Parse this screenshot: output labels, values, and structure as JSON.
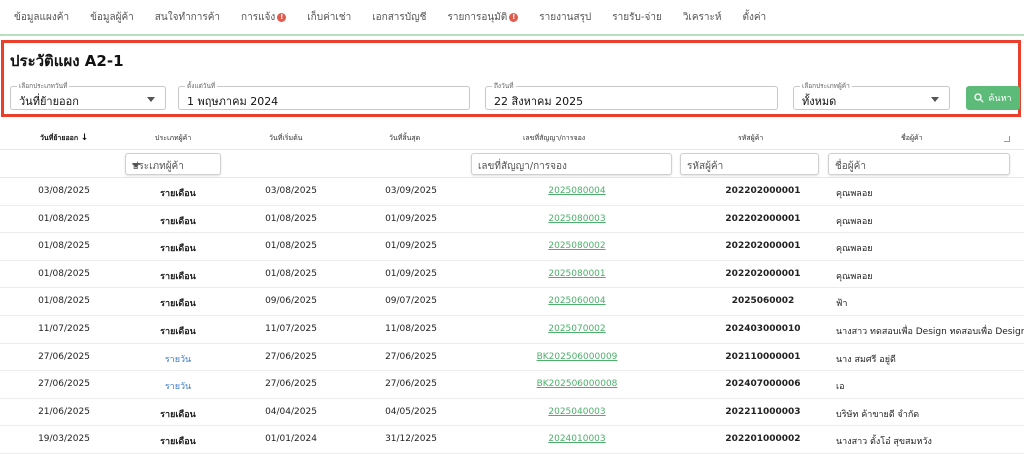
{
  "nav": [
    {
      "label": "ข้อมูลแผงค้า",
      "badge": ""
    },
    {
      "label": "ข้อมูลผู้ค้า",
      "badge": ""
    },
    {
      "label": "สนใจทำการค้า",
      "badge": ""
    },
    {
      "label": "การแจ้ง",
      "badge": "!"
    },
    {
      "label": "เก็บค่าเช่า",
      "badge": ""
    },
    {
      "label": "เอกสารบัญชี",
      "badge": ""
    },
    {
      "label": "รายการอนุมัติ",
      "badge": "!"
    },
    {
      "label": "รายงานสรุป",
      "badge": ""
    },
    {
      "label": "รายรับ-จ่าย",
      "badge": ""
    },
    {
      "label": "วิเคราะห์",
      "badge": ""
    },
    {
      "label": "ตั้งค่า",
      "badge": ""
    }
  ],
  "page_title": "ประวัติแผง A2-1",
  "filters": {
    "date_type": {
      "label": "เลือกประเภทวันที่",
      "value": "วันที่ย้ายออก"
    },
    "from_date": {
      "label": "ตั้งแต่วันที่",
      "value": "1 พฤษภาคม 2024"
    },
    "to_date": {
      "label": "ถึงวันที่",
      "value": "22 สิงหาคม 2025"
    },
    "customer_type": {
      "label": "เลือกประเภทผู้ค้า",
      "value": "ทั้งหมด"
    },
    "search_label": "ค้นหา"
  },
  "columns": {
    "move_out": "วันที่ย้ายออก",
    "customer_type": "ประเภทผู้ค้า",
    "start": "วันที่เริ่มต้น",
    "end": "วันที่สิ้นสุด",
    "contract": "เลขที่สัญญา/การจอง",
    "customer_code": "รหัสผู้ค้า",
    "customer_name": "ชื่อผู้ค้า"
  },
  "column_filters": {
    "customer_type": "ประเภทผู้ค้า",
    "contract": "เลขที่สัญญา/การจอง",
    "customer_code": "รหัสผู้ค้า",
    "customer_name": "ชื่อผู้ค้า"
  },
  "rows": [
    {
      "move_out": "03/08/2025",
      "type": "รายเดือน",
      "daily": false,
      "start": "03/08/2025",
      "end": "03/09/2025",
      "contract": "2025080004",
      "code": "202202000001",
      "name": "คุณพลอย"
    },
    {
      "move_out": "01/08/2025",
      "type": "รายเดือน",
      "daily": false,
      "start": "01/08/2025",
      "end": "01/09/2025",
      "contract": "2025080003",
      "code": "202202000001",
      "name": "คุณพลอย"
    },
    {
      "move_out": "01/08/2025",
      "type": "รายเดือน",
      "daily": false,
      "start": "01/08/2025",
      "end": "01/09/2025",
      "contract": "2025080002",
      "code": "202202000001",
      "name": "คุณพลอย"
    },
    {
      "move_out": "01/08/2025",
      "type": "รายเดือน",
      "daily": false,
      "start": "01/08/2025",
      "end": "01/09/2025",
      "contract": "2025080001",
      "code": "202202000001",
      "name": "คุณพลอย"
    },
    {
      "move_out": "01/08/2025",
      "type": "รายเดือน",
      "daily": false,
      "start": "09/06/2025",
      "end": "09/07/2025",
      "contract": "2025060004",
      "code": "2025060002",
      "name": "ฟ้า"
    },
    {
      "move_out": "11/07/2025",
      "type": "รายเดือน",
      "daily": false,
      "start": "11/07/2025",
      "end": "11/08/2025",
      "contract": "2025070002",
      "code": "202403000010",
      "name": "นางสาว ทดสอบเพื่อ Design ทดสอบเพื่อ Design"
    },
    {
      "move_out": "27/06/2025",
      "type": "รายวัน",
      "daily": true,
      "start": "27/06/2025",
      "end": "27/06/2025",
      "contract": "BK202506000009",
      "code": "202110000001",
      "name": "นาง สมศรี อยู่ดี"
    },
    {
      "move_out": "27/06/2025",
      "type": "รายวัน",
      "daily": true,
      "start": "27/06/2025",
      "end": "27/06/2025",
      "contract": "BK202506000008",
      "code": "202407000006",
      "name": "เอ"
    },
    {
      "move_out": "21/06/2025",
      "type": "รายเดือน",
      "daily": false,
      "start": "04/04/2025",
      "end": "04/05/2025",
      "contract": "2025040003",
      "code": "202211000003",
      "name": "บริษัท ค้าขายดี จำกัด"
    },
    {
      "move_out": "19/03/2025",
      "type": "รายเดือน",
      "daily": false,
      "start": "01/01/2024",
      "end": "31/12/2025",
      "contract": "2024010003",
      "code": "202201000002",
      "name": "นางสาว ตั้งโอ๋ สุขสมหวัง"
    }
  ],
  "colors": {
    "accent": "#5dbb7a",
    "highlight": "#e8402c",
    "link": "#4caf6a",
    "daily": "#3a7bc8"
  }
}
